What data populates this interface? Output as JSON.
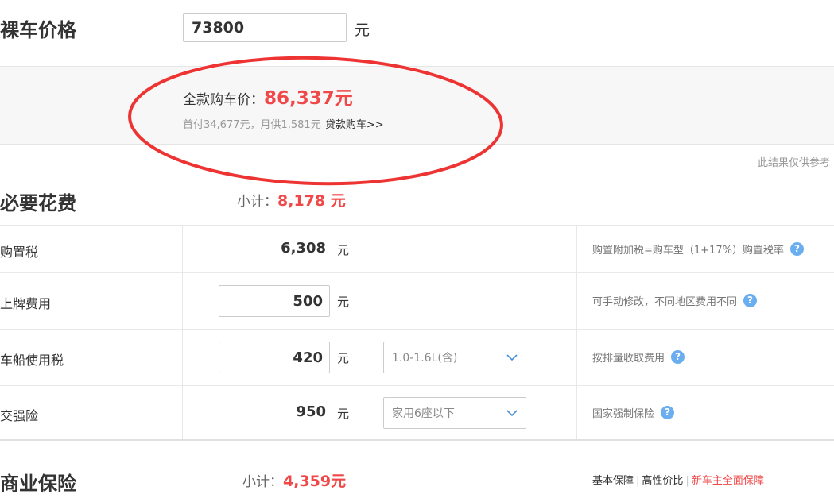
{
  "car_price": {
    "label": "裸车价格",
    "value": "73800",
    "unit": "元"
  },
  "total": {
    "label": "全款购车价：",
    "value": "86,337元",
    "loan_info": "首付34,677元，月供1,581元",
    "loan_link": "贷款购车>>"
  },
  "note": "此结果仅供参考",
  "required": {
    "title": "必要花费",
    "subtotal_label": "小计：",
    "subtotal_value": "8,178 元",
    "rows": [
      {
        "label": "购置税",
        "value": "6,308",
        "unit": "元",
        "desc": "购置附加税=购车型（1+17%）购置税率"
      },
      {
        "label": "上牌费用",
        "value": "500",
        "unit": "元",
        "desc": "可手动修改，不同地区费用不同"
      },
      {
        "label": "车船使用税",
        "value": "420",
        "unit": "元",
        "select": "1.0-1.6L(含)",
        "desc": "按排量收取费用"
      },
      {
        "label": "交强险",
        "value": "950",
        "unit": "元",
        "select": "家用6座以下",
        "desc": "国家强制保险"
      }
    ]
  },
  "commercial": {
    "title": "商业保险",
    "subtotal_label": "小计：",
    "subtotal_value": "4,359元",
    "plans": [
      "基本保障",
      "高性价比",
      "新车主全面保障"
    ]
  },
  "icons": {
    "help": "question-circle-icon",
    "dropdown": "chevron-down-icon"
  },
  "colors": {
    "accent": "#f04848",
    "help_icon": "#6aaef0",
    "annotation": "#ee3333"
  }
}
